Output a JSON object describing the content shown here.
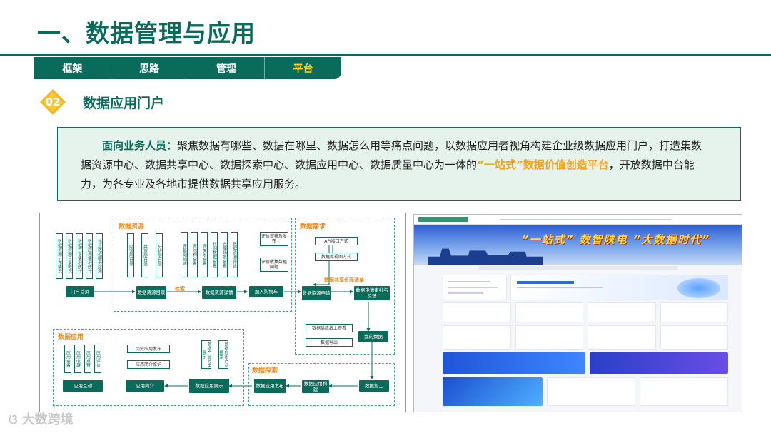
{
  "page": {
    "title": "一、数据管理与应用"
  },
  "tabs": [
    {
      "label": "框架",
      "active": false
    },
    {
      "label": "思路",
      "active": false
    },
    {
      "label": "管理",
      "active": false
    },
    {
      "label": "平台",
      "active": true
    }
  ],
  "section": {
    "number": "02",
    "title": "数据应用门户"
  },
  "description": {
    "lead": "面向业务人员：",
    "part1": "聚焦数据有哪些、数据在哪里、数据怎么用等痛点问题，以数据应用者视角构建企业级数据应用门户，打造集数据资源中心、数据共享中心、数据探索中心、数据应用中心、数据质量中心为一体的",
    "highlight": "“一站式”数据价值创造平台",
    "part2": "，开放数据中台能力，为各专业及各地市提供数据共享应用服务。"
  },
  "diagram": {
    "groups": {
      "resource": "数据资源",
      "demand": "数据需求",
      "application": "数据应用",
      "explore": "数据探索"
    },
    "portal_items": [
      "数据资源分布情况",
      "数据资源目录概况",
      "数据共享情况统计",
      "数据应用情况统计",
      "热点数据服务应用"
    ],
    "catalog_items": [
      "贴源层目录",
      "共享层目录",
      "分析层目录"
    ],
    "detail_items": [
      "表基础描述",
      "表结构查看",
      "表关系查看",
      "样例数据查看",
      "支撑场景查看",
      "数据资源评论"
    ],
    "review_items": [
      "评价审核及发布",
      "评价收集数据问题"
    ],
    "api_items": [
      "API接口方式",
      "数据库视图方式"
    ],
    "nodes": {
      "portal_home": "门户首页",
      "catalog": "数据资源目录",
      "detail": "数据资源详情",
      "cart": "加入购物车",
      "apply": "数据资源申请",
      "approve": "数据申请审批与反馈",
      "my_data": "我的数据",
      "processing": "数据加工",
      "build": "数据应用构建",
      "publish": "数据应用发布",
      "display": "数据应用展示",
      "intro": "应用简介",
      "interact": "应用互动"
    },
    "tags": {
      "search": "检索",
      "share_list": "数据共享负面清单"
    },
    "my_data_items": [
      "数据供应线上查看",
      "数据导出"
    ],
    "history_items": [
      "历史应用发布",
      "应用简介维护"
    ],
    "display_items": [
      "数据产品分类展示",
      "数据应用产品搜索"
    ],
    "interact_items": [
      "应用查看",
      "应用收藏",
      "应用点赞",
      "应用评价"
    ]
  },
  "portal_screenshot": {
    "slogan": "“一站式” 数智陕电 “大数据时代”"
  },
  "watermark": "大数跨境"
}
